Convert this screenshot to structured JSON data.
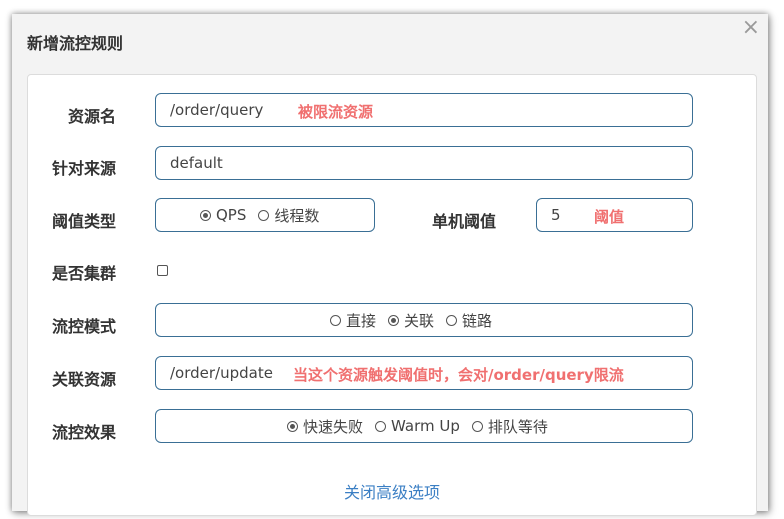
{
  "dialog": {
    "title": "新增流控规则",
    "close_glyph": "×"
  },
  "form": {
    "resource": {
      "label": "资源名",
      "value": "/order/query",
      "note": "被限流资源"
    },
    "origin": {
      "label": "针对来源",
      "value": "default"
    },
    "threshold_type": {
      "label": "阈值类型",
      "options": [
        {
          "label": "QPS",
          "selected": true
        },
        {
          "label": "线程数",
          "selected": false
        }
      ]
    },
    "single_threshold": {
      "label": "单机阈值",
      "value": "5",
      "note": "阈值"
    },
    "cluster": {
      "label": "是否集群",
      "checked": false
    },
    "control_mode": {
      "label": "流控模式",
      "options": [
        {
          "label": "直接",
          "selected": false
        },
        {
          "label": "关联",
          "selected": true
        },
        {
          "label": "链路",
          "selected": false
        }
      ]
    },
    "related_resource": {
      "label": "关联资源",
      "value": "/order/update",
      "note": "当这个资源触发阈值时，会对/order/query限流"
    },
    "effect": {
      "label": "流控效果",
      "options": [
        {
          "label": "快速失败",
          "selected": true
        },
        {
          "label": "Warm Up",
          "selected": false
        },
        {
          "label": "排队等待",
          "selected": false
        }
      ]
    }
  },
  "advanced_link": "关闭高级选项",
  "colors": {
    "accent_border": "#3a6f95",
    "note": "#f07070",
    "link": "#3b7fc4"
  }
}
